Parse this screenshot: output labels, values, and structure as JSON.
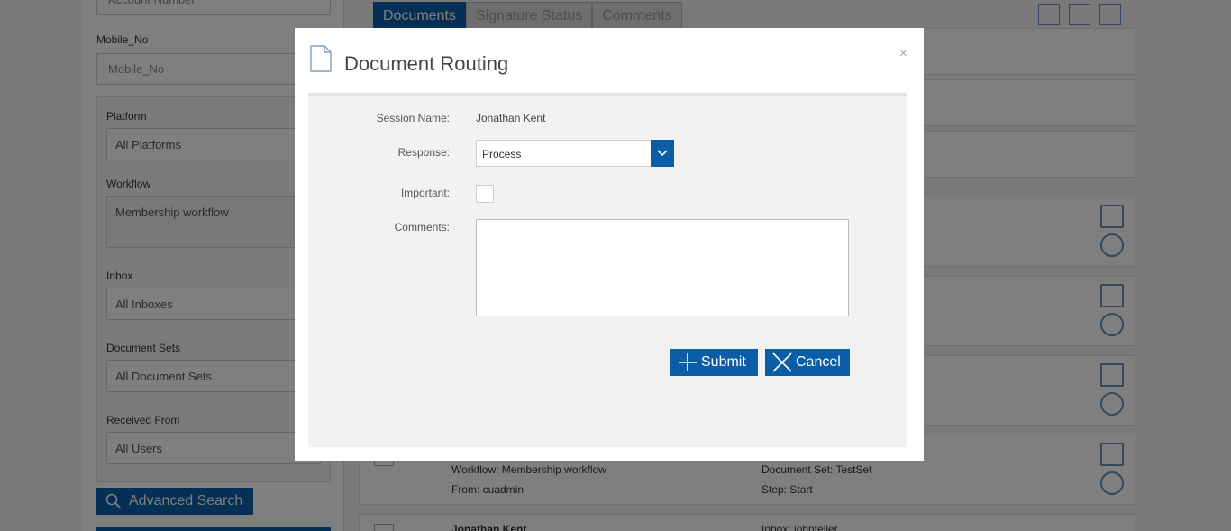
{
  "background": {
    "account_number_placeholder": "Account Number",
    "mobile_label": "Mobile_No",
    "mobile_placeholder": "Mobile_No",
    "filters": [
      {
        "label": "Platform",
        "value": "All Platforms"
      },
      {
        "label": "Workflow",
        "value": "Membership workflow"
      },
      {
        "label": "Inbox",
        "value": "All Inboxes"
      },
      {
        "label": "Document Sets",
        "value": "All Document Sets"
      },
      {
        "label": "Received From",
        "value": "All Users"
      }
    ],
    "advanced_search_label": "Advanced Search",
    "tabs": [
      "Documents",
      "Signature Status",
      "Comments"
    ],
    "card_workflow": "Workflow: Membership workflow",
    "card_from": "From: cuadmin",
    "card_docset": "Document Set: TestSet",
    "card_step": "Step: Start",
    "card_name": "Jonathan Kent",
    "card_inbox": "Inbox: johnteller"
  },
  "modal": {
    "title": "Document Routing",
    "close_glyph": "×",
    "session_label": "Session Name:",
    "session_value": "Jonathan Kent",
    "response_label": "Response:",
    "response_value": "Process",
    "important_label": "Important:",
    "comments_label": "Comments:",
    "comments_value": "",
    "submit_label": "Submit",
    "cancel_label": "Cancel"
  },
  "colors": {
    "accent": "#0a5ea8",
    "overlay": "rgba(0,0,0,0.5)",
    "body_bg": "#f2f2f2"
  }
}
